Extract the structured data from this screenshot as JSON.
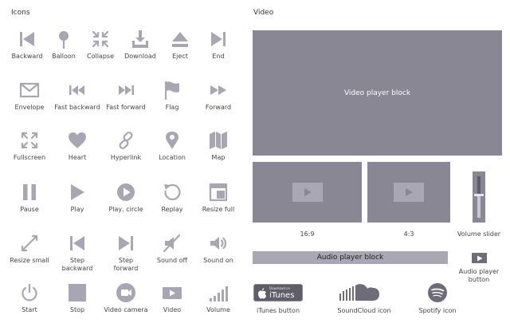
{
  "sections": {
    "icons_title": "Icons",
    "video_title": "Video"
  },
  "icons": [
    [
      "Backward",
      "Balloon",
      "Collapse",
      "Download",
      "Eject",
      "End"
    ],
    [
      "Envelope",
      "Fast backward",
      "Fast forward",
      "Flag",
      "Forward"
    ],
    [
      "Fullscreen",
      "Heart",
      "Hyperlink",
      "Location",
      "Map"
    ],
    [
      "Pause",
      "Play",
      "Play, circle",
      "Replay",
      "Resize full"
    ],
    [
      "Resize small",
      "Step\nbackward",
      "Step\nforward",
      "Sound off",
      "Sound on"
    ],
    [
      "Start",
      "Stop",
      "Video camera",
      "Video",
      "Volume"
    ]
  ],
  "video": {
    "player_block_label": "Video player block",
    "ratio_16_9": "16:9",
    "ratio_4_3": "4:3",
    "volume_slider_label": "Volume slider",
    "volume_level": 0.55,
    "audio_block_label": "Audio player block",
    "audio_button_label": "Audio player\nbutton",
    "itunes_label": "iTunes button",
    "itunes_badge_small": "Download on",
    "itunes_badge_big": "iTunes",
    "soundcloud_label": "SoundCloud icon",
    "spotify_label": "Spotify icon"
  },
  "colors": {
    "icon": "#a8a6b3",
    "block": "#8a8794",
    "block_light": "#a9a7b3"
  }
}
